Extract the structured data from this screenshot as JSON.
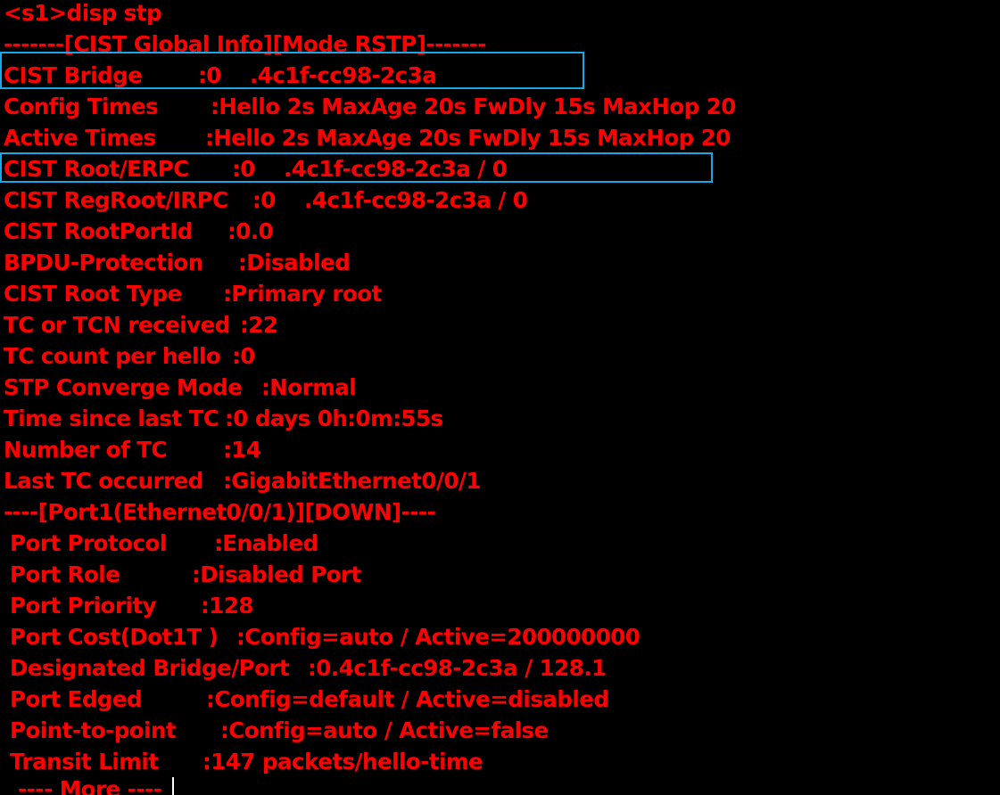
{
  "terminal": {
    "prompt_line": "<s1>disp stp",
    "global_header": "-------[CIST Global Info][Mode RSTP]-------",
    "global": [
      {
        "key": "CIST Bridge",
        "value": ":0    .4c1f-cc98-2c3a"
      },
      {
        "key": "Config Times",
        "value": ":Hello 2s MaxAge 20s FwDly 15s MaxHop 20"
      },
      {
        "key": "Active Times",
        "value": ":Hello 2s MaxAge 20s FwDly 15s MaxHop 20"
      },
      {
        "key": "CIST Root/ERPC",
        "value": ":0    .4c1f-cc98-2c3a / 0"
      },
      {
        "key": "CIST RegRoot/IRPC",
        "value": ":0    .4c1f-cc98-2c3a / 0"
      },
      {
        "key": "CIST RootPortId",
        "value": ":0.0"
      },
      {
        "key": "BPDU-Protection",
        "value": ":Disabled"
      },
      {
        "key": "CIST Root Type",
        "value": ":Primary root"
      },
      {
        "key": "TC or TCN received",
        "value": ":22"
      },
      {
        "key": "TC count per hello",
        "value": ":0"
      },
      {
        "key": "STP Converge Mode",
        "value": ":Normal"
      },
      {
        "key": "Time since last TC",
        "value": ":0 days 0h:0m:55s"
      },
      {
        "key": "Number of TC",
        "value": ":14"
      },
      {
        "key": "Last TC occurred",
        "value": ":GigabitEthernet0/0/1"
      }
    ],
    "port_header": "----[Port1(Ethernet0/0/1)][DOWN]----",
    "port": [
      {
        "key": "Port Protocol",
        "value": ":Enabled"
      },
      {
        "key": "Port Role",
        "value": ":Disabled Port"
      },
      {
        "key": "Port Priority",
        "value": ":128"
      },
      {
        "key": "Port Cost(Dot1T )",
        "value": ":Config=auto / Active=200000000"
      },
      {
        "key": "Designated Bridge/Port",
        "value": ":0.4c1f-cc98-2c3a / 128.1"
      },
      {
        "key": "Port Edged",
        "value": ":Config=default / Active=disabled"
      },
      {
        "key": "Point-to-point",
        "value": ":Config=auto / Active=false"
      },
      {
        "key": "Transit Limit",
        "value": ":147 packets/hello-time"
      }
    ],
    "more_prompt": "  ---- More ----",
    "colors": {
      "background": "#000000",
      "text": "#ff0000",
      "highlight_box": "#1aa7e6",
      "cursor": "#ffffff"
    }
  }
}
